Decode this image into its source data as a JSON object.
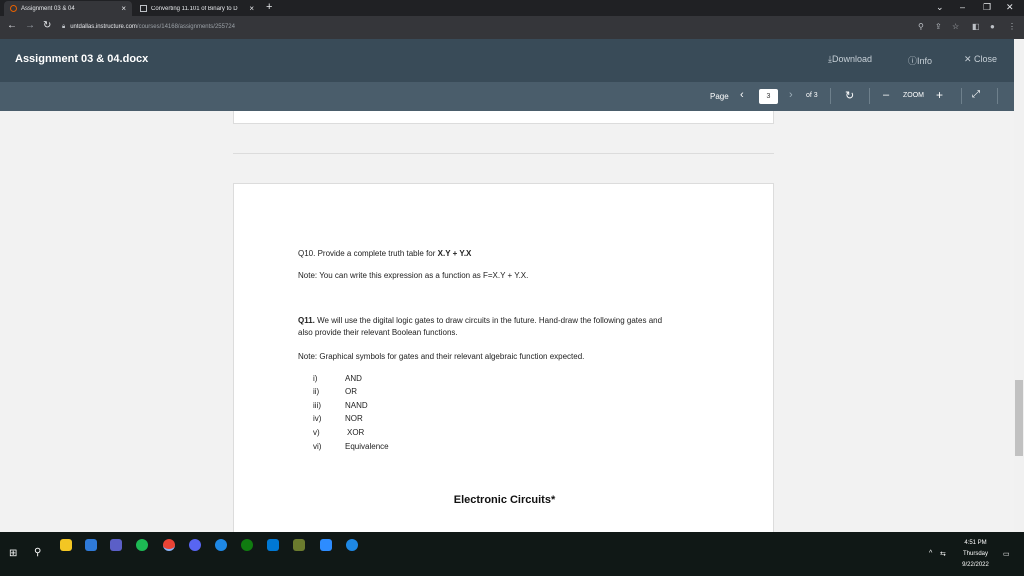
{
  "browser": {
    "tabs": [
      {
        "title": "Assignment 03 & 04",
        "active": true
      },
      {
        "title": "Converting 11.101 of Binary to D",
        "active": false
      }
    ],
    "new_tab": "+",
    "url_domain": "untdallas.instructure.com",
    "url_path": "/courses/14168/assignments/255724"
  },
  "viewer": {
    "title": "Assignment 03 & 04.docx",
    "download": "Download",
    "info": "Info",
    "close": "Close",
    "page_label": "Page",
    "page_current": "3",
    "page_total": "of 3",
    "zoom_label": "ZOOM",
    "zoom_minus": "–",
    "zoom_plus": "+"
  },
  "document": {
    "q10_text": "Q10. Provide a complete truth table for ",
    "q10_expr": "X.Y + Y.X",
    "note1": "Note: You can write this expression as a function as F=X.Y + Y.X.",
    "q11_label": "Q11.",
    "q11_line1": " We will use the digital logic gates to draw circuits in the future. Hand-draw the following gates and",
    "q11_line2": "also provide their relevant Boolean functions.",
    "note2": "Note: Graphical symbols for gates and their relevant algebraic function expected.",
    "gates": [
      {
        "num": "i)",
        "name": "AND"
      },
      {
        "num": "ii)",
        "name": "OR"
      },
      {
        "num": "iii)",
        "name": "NAND"
      },
      {
        "num": "iv)",
        "name": "NOR"
      },
      {
        "num": "v)",
        "name": "XOR"
      },
      {
        "num": "vi)",
        "name": "Equivalence"
      }
    ],
    "footer": "Electronic Circuits*"
  },
  "taskbar": {
    "time": "4:51 PM",
    "day": "Thursday",
    "date": "9/22/2022"
  },
  "colors": {
    "header_bg": "#394b58",
    "toolbar_bg": "#4a5d6b",
    "browser_bg": "#35363a"
  }
}
